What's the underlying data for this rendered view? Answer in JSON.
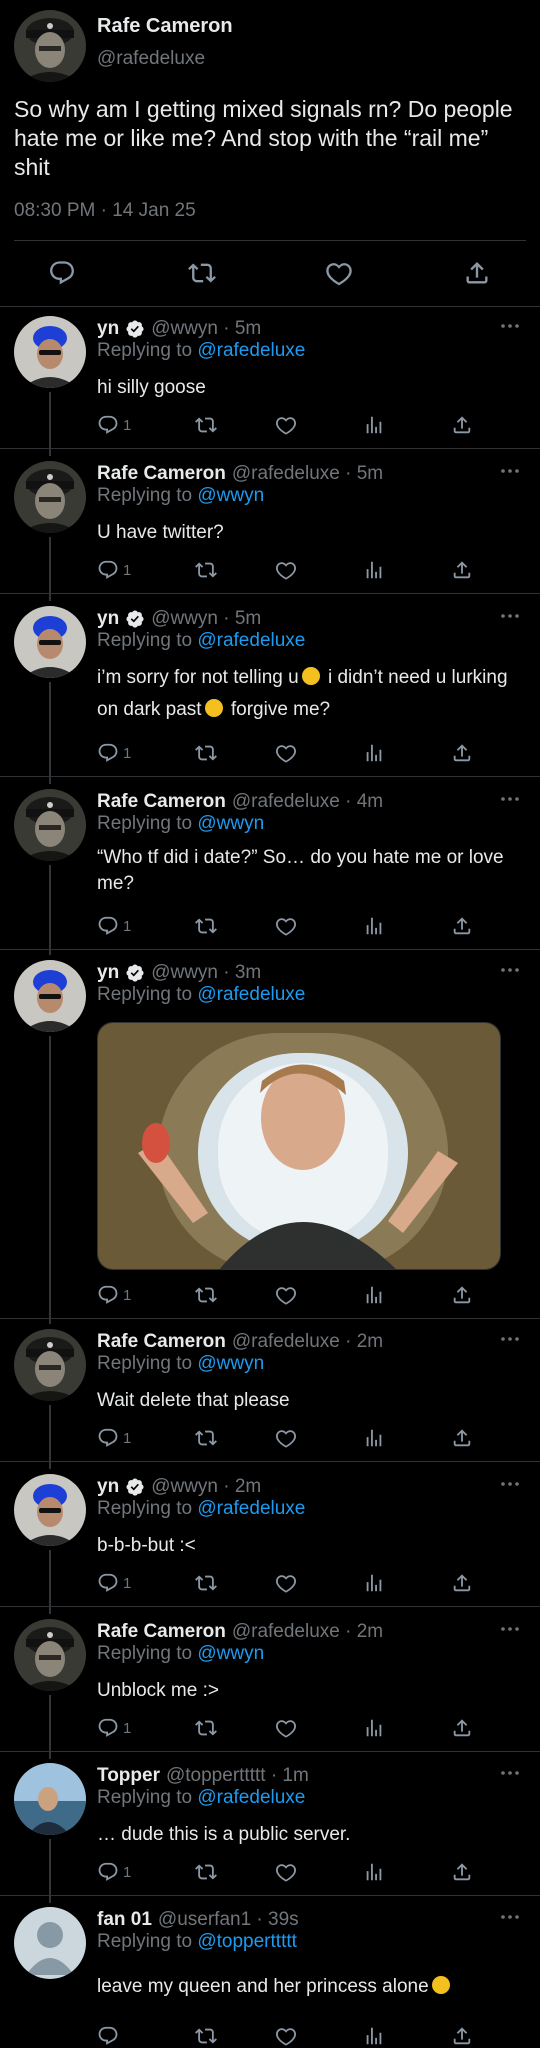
{
  "main_tweet": {
    "author": "Rafe Cameron",
    "handle": "@rafedeluxe",
    "text": "So why am I getting mixed signals rn? Do people hate me or like me? And stop with the “rail me” shit",
    "timestamp": "08:30 PM · 14 Jan 25",
    "action_icons": [
      "reply-icon",
      "retweet-icon",
      "like-icon",
      "share-icon"
    ]
  },
  "replies": [
    {
      "author": "yn",
      "verified": true,
      "meta": "@wwyn · 5m",
      "replying_label": "Replying to",
      "replying_to": "@rafedeluxe",
      "text": "hi silly goose",
      "reply_count": "1"
    },
    {
      "author": "Rafe Cameron",
      "verified": false,
      "meta": "@rafedeluxe · 5m",
      "replying_label": "Replying to",
      "replying_to": "@wwyn",
      "text": "U have twitter?",
      "reply_count": "1"
    },
    {
      "author": "yn",
      "verified": true,
      "meta": "@wwyn · 5m",
      "replying_label": "Replying to",
      "replying_to": "@rafedeluxe",
      "text_part1": "i’m sorry for not telling u",
      "text_part2": " i didn’t need u lurking on dark past",
      "text_part3": " forgive me?",
      "reply_count": "1"
    },
    {
      "author": "Rafe Cameron",
      "verified": false,
      "meta": "@rafedeluxe · 4m",
      "replying_label": "Replying to",
      "replying_to": "@wwyn",
      "text": "“Who tf did i date?” So… do you hate me or love me?",
      "reply_count": "1"
    },
    {
      "author": "yn",
      "verified": true,
      "meta": "@wwyn · 3m",
      "replying_label": "Replying to",
      "replying_to": "@rafedeluxe",
      "media": "photo",
      "reply_count": "1"
    },
    {
      "author": "Rafe Cameron",
      "verified": false,
      "meta": "@rafedeluxe · 2m",
      "replying_label": "Replying to",
      "replying_to": "@wwyn",
      "text": "Wait delete that please",
      "reply_count": "1"
    },
    {
      "author": "yn",
      "verified": true,
      "meta": "@wwyn · 2m",
      "replying_label": "Replying to",
      "replying_to": "@rafedeluxe",
      "text": "b-b-b-but :<",
      "reply_count": "1"
    },
    {
      "author": "Rafe Cameron",
      "verified": false,
      "meta": "@rafedeluxe · 2m",
      "replying_label": "Replying to",
      "replying_to": "@wwyn",
      "text": "Unblock me :>",
      "reply_count": "1"
    },
    {
      "author": "Topper",
      "verified": false,
      "meta": "@topperttttt · 1m",
      "replying_label": "Replying to",
      "replying_to": "@rafedeluxe",
      "text": "… dude this is a public server.",
      "reply_count": "1"
    },
    {
      "author": "fan 01",
      "verified": false,
      "meta": "@userfan1 · 39s",
      "replying_label": "Replying to",
      "replying_to": "@topperttttt",
      "text": "leave my queen and her princess alone",
      "reply_count": ""
    }
  ],
  "colors": {
    "background": "#000000",
    "text": "#e7e9ea",
    "muted": "#71767b",
    "link": "#1d9bf0",
    "divider": "#2f3336"
  }
}
